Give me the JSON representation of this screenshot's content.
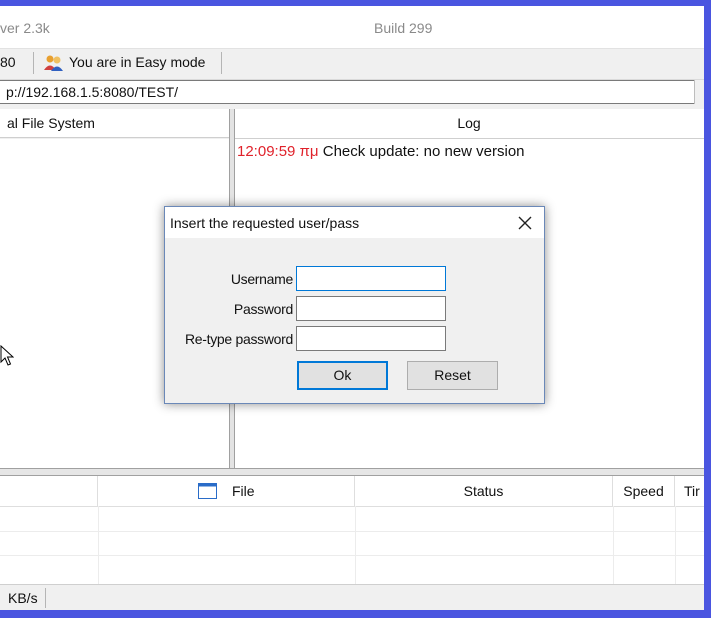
{
  "window": {
    "title_fragment": "ver 2.3k",
    "build": "Build 299"
  },
  "toolbar": {
    "port_fragment": "80",
    "mode_label": "You are in Easy mode"
  },
  "url_bar": {
    "value": "p://192.168.1.5:8080/TEST/"
  },
  "panes": {
    "vfs_header": "al File System",
    "log_header": "Log",
    "log_entries": [
      {
        "time": "12:09:59 πμ",
        "message": "Check update: no new version"
      }
    ]
  },
  "transfers": {
    "columns": [
      "File",
      "Status",
      "Speed",
      "Tir"
    ]
  },
  "statusbar": {
    "speed": "KB/s"
  },
  "dialog": {
    "title": "Insert the requested user/pass",
    "fields": [
      {
        "label": "Username",
        "value": ""
      },
      {
        "label": "Password",
        "value": ""
      },
      {
        "label": "Re-type password",
        "value": ""
      }
    ],
    "ok_label": "Ok",
    "reset_label": "Reset"
  },
  "colors": {
    "desktop": "#4a55e0",
    "log_time": "#e0222b",
    "focus": "#0078d7"
  }
}
